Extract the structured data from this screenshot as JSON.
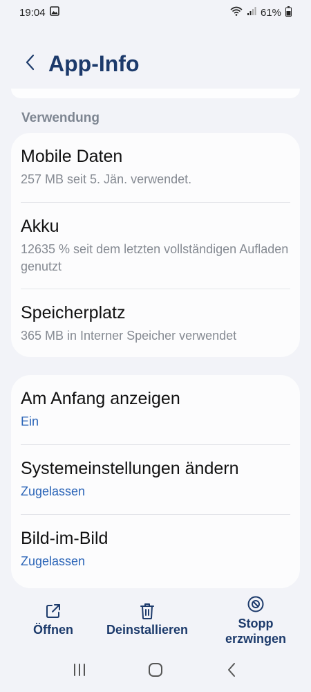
{
  "status_bar": {
    "time": "19:04",
    "battery": "61%",
    "icons": [
      "image-icon",
      "wifi-icon",
      "signal-icon",
      "battery-icon"
    ]
  },
  "header": {
    "title": "App-Info",
    "back_icon": "chevron-left-icon"
  },
  "usage_section": {
    "label": "Verwendung",
    "items": [
      {
        "title": "Mobile Daten",
        "subtitle": "257 MB seit 5. Jän. verwendet."
      },
      {
        "title": "Akku",
        "subtitle": "12635 % seit dem letzten vollständigen Aufladen genutzt"
      },
      {
        "title": "Speicherplatz",
        "subtitle": "365 MB in Interner Speicher verwendet"
      }
    ]
  },
  "permissions_section": {
    "items": [
      {
        "title": "Am Anfang anzeigen",
        "value": "Ein"
      },
      {
        "title": "Systemeinstellungen ändern",
        "value": "Zugelassen"
      },
      {
        "title": "Bild-im-Bild",
        "value": "Zugelassen"
      }
    ]
  },
  "actions": [
    {
      "label": "Öffnen",
      "icon": "open-external-icon"
    },
    {
      "label": "Deinstallieren",
      "icon": "trash-icon"
    },
    {
      "label": "Stopp erzwingen",
      "icon": "block-icon"
    }
  ],
  "nav_bar": {
    "icons": [
      "recents-icon",
      "home-icon",
      "back-icon"
    ]
  },
  "colors": {
    "background": "#f2f3f8",
    "card": "#fcfcfd",
    "title": "#1c3a6b",
    "accent": "#2a64b7",
    "secondary_text": "#858a92",
    "section_label": "#7d8591"
  }
}
